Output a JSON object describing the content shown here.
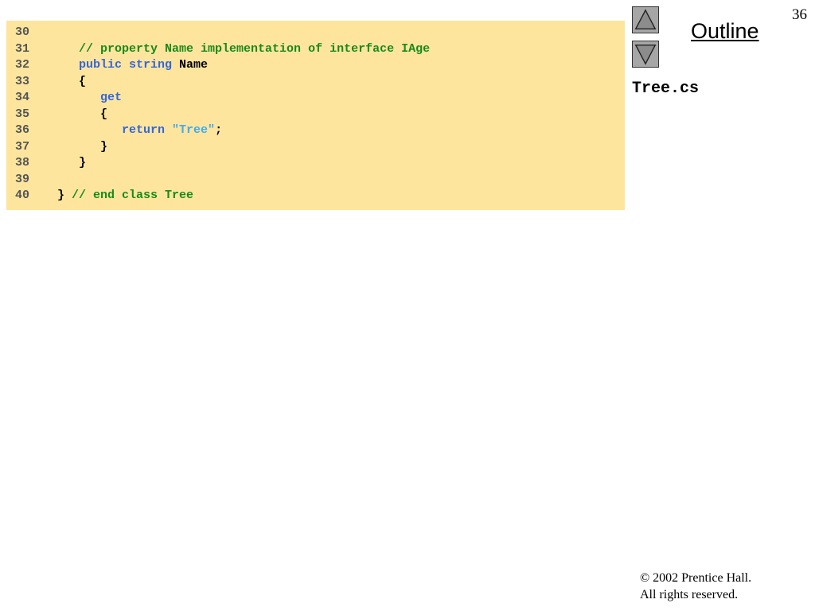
{
  "slide": {
    "page_number": "36",
    "outline_label": "Outline",
    "file_name": "Tree.cs",
    "copyright_line1": "© 2002 Prentice Hall.",
    "copyright_line2": "All rights reserved."
  },
  "nav": {
    "up_icon": "triangle-up-icon",
    "down_icon": "triangle-down-icon"
  },
  "colors": {
    "code_background": "#fde59e",
    "keyword": "#3366dd",
    "comment": "#1a8a1a",
    "string": "#44aaee",
    "line_number": "#555555"
  },
  "code": {
    "lines": [
      {
        "num": "30",
        "indent": "",
        "tokens": []
      },
      {
        "num": "31",
        "indent": "   ",
        "tokens": [
          {
            "type": "cm",
            "text": "// property Name implementation of interface IAge"
          }
        ]
      },
      {
        "num": "32",
        "indent": "   ",
        "tokens": [
          {
            "type": "kw",
            "text": "public string"
          },
          {
            "type": "plain",
            "text": " Name"
          }
        ]
      },
      {
        "num": "33",
        "indent": "   ",
        "tokens": [
          {
            "type": "plain",
            "text": "{"
          }
        ]
      },
      {
        "num": "34",
        "indent": "      ",
        "tokens": [
          {
            "type": "kw",
            "text": "get"
          }
        ]
      },
      {
        "num": "35",
        "indent": "      ",
        "tokens": [
          {
            "type": "plain",
            "text": "{"
          }
        ]
      },
      {
        "num": "36",
        "indent": "         ",
        "tokens": [
          {
            "type": "kw",
            "text": "return"
          },
          {
            "type": "plain",
            "text": " "
          },
          {
            "type": "str",
            "text": "\"Tree\""
          },
          {
            "type": "plain",
            "text": ";"
          }
        ]
      },
      {
        "num": "37",
        "indent": "      ",
        "tokens": [
          {
            "type": "plain",
            "text": "}"
          }
        ]
      },
      {
        "num": "38",
        "indent": "   ",
        "tokens": [
          {
            "type": "plain",
            "text": "}"
          }
        ]
      },
      {
        "num": "39",
        "indent": "",
        "tokens": []
      },
      {
        "num": "40",
        "indent": "",
        "tokens": [
          {
            "type": "plain",
            "text": "} "
          },
          {
            "type": "cm",
            "text": "// end class Tree"
          }
        ]
      }
    ]
  }
}
